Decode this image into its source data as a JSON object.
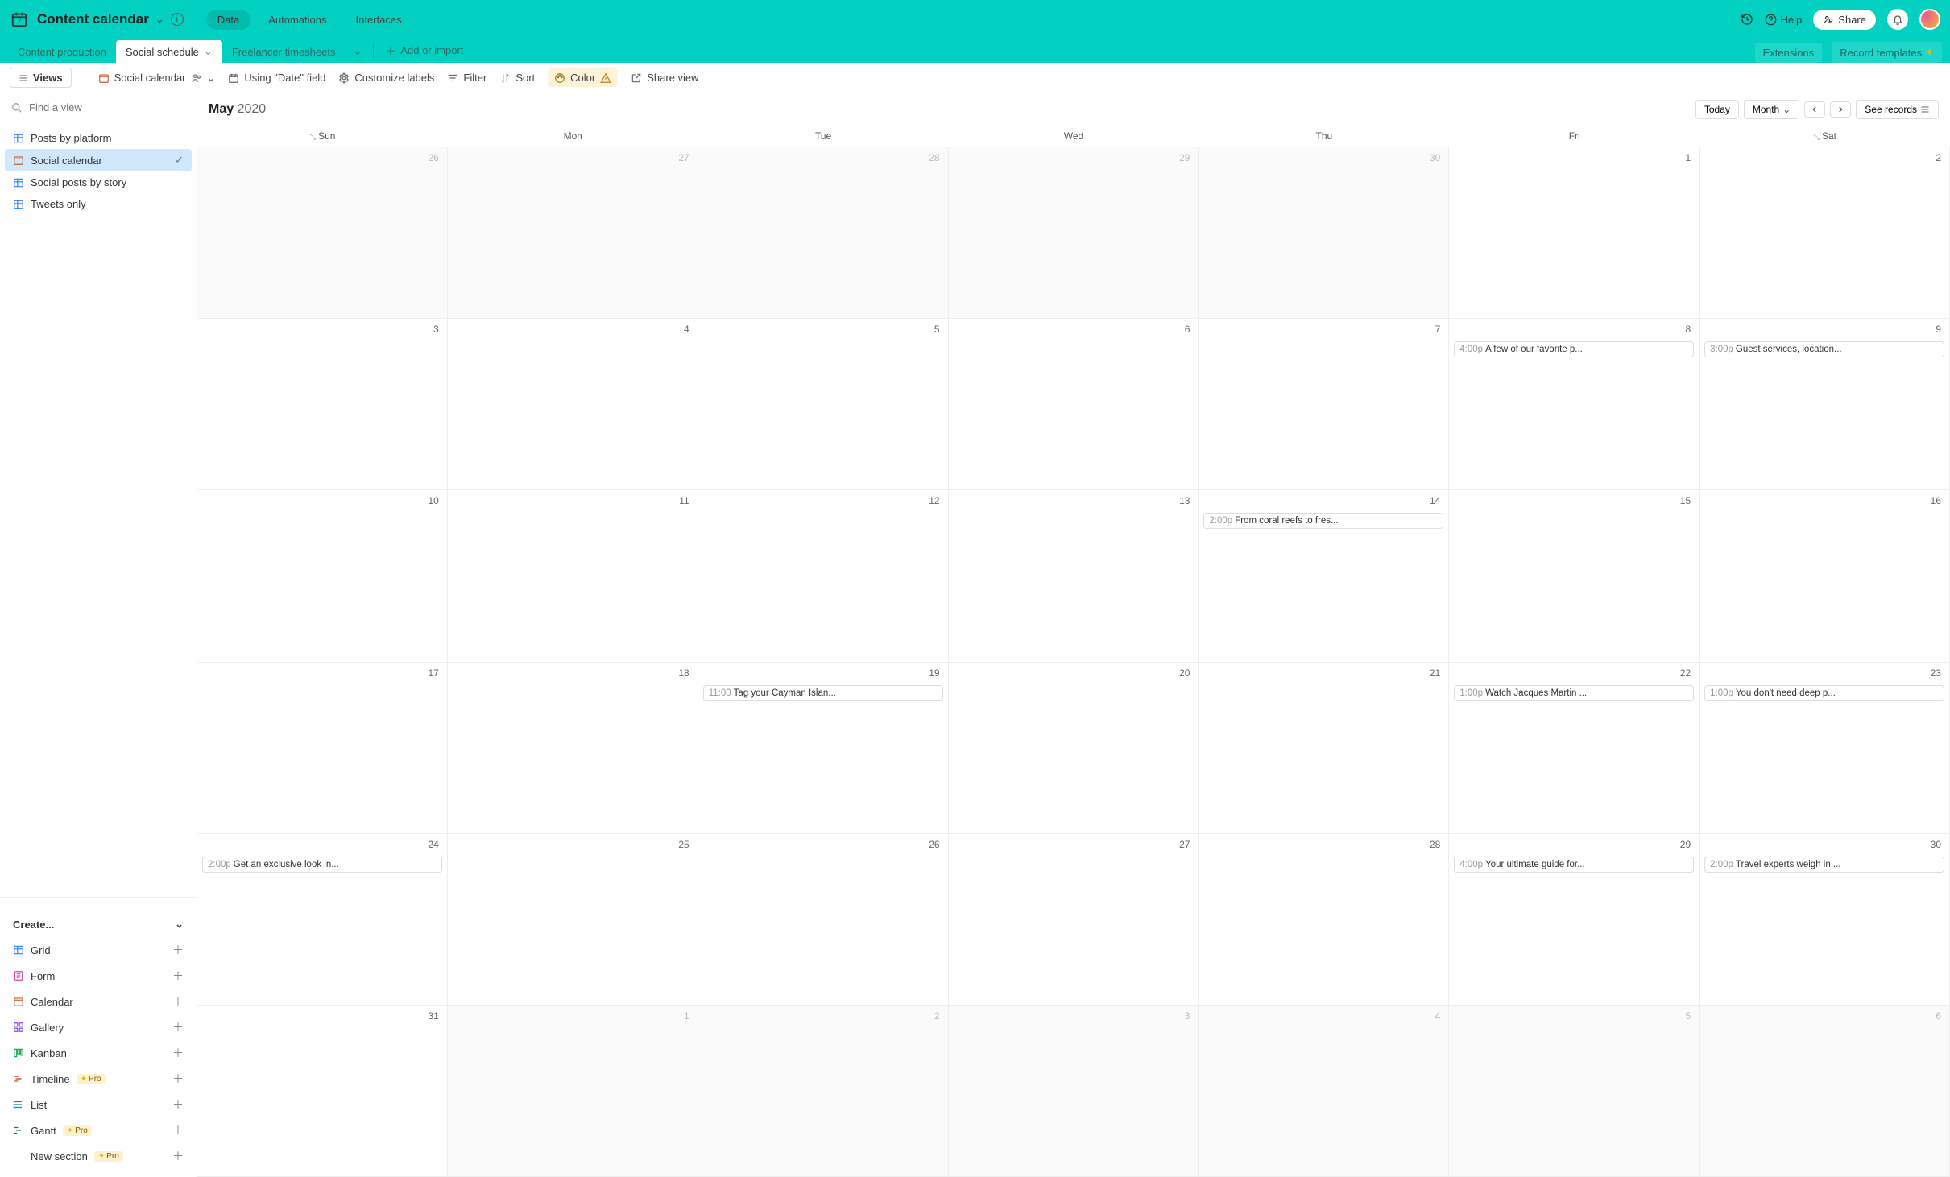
{
  "header": {
    "base_name": "Content calendar",
    "modes": {
      "data": "Data",
      "automations": "Automations",
      "interfaces": "Interfaces"
    },
    "help": "Help",
    "share": "Share"
  },
  "tables": {
    "tabs": [
      {
        "label": "Content production",
        "active": false
      },
      {
        "label": "Social schedule",
        "active": true
      },
      {
        "label": "Freelancer timesheets",
        "active": false
      }
    ],
    "add_or_import": "Add or import",
    "extensions": "Extensions",
    "record_templates": "Record templates"
  },
  "toolbar": {
    "views": "Views",
    "current_view": "Social calendar",
    "using_field": "Using \"Date\" field",
    "customize": "Customize labels",
    "filter": "Filter",
    "sort": "Sort",
    "color": "Color",
    "share_view": "Share view"
  },
  "sidebar": {
    "find_placeholder": "Find a view",
    "views": [
      {
        "label": "Posts by platform",
        "type": "grid",
        "active": false
      },
      {
        "label": "Social calendar",
        "type": "calendar",
        "active": true
      },
      {
        "label": "Social posts by story",
        "type": "grid",
        "active": false
      },
      {
        "label": "Tweets only",
        "type": "grid",
        "active": false
      }
    ],
    "create_label": "Create...",
    "create_items": [
      {
        "label": "Grid",
        "icon": "grid",
        "pro": false
      },
      {
        "label": "Form",
        "icon": "form",
        "pro": false
      },
      {
        "label": "Calendar",
        "icon": "calendar",
        "pro": false
      },
      {
        "label": "Gallery",
        "icon": "gallery",
        "pro": false
      },
      {
        "label": "Kanban",
        "icon": "kanban",
        "pro": false
      },
      {
        "label": "Timeline",
        "icon": "timeline",
        "pro": true
      },
      {
        "label": "List",
        "icon": "list",
        "pro": false
      },
      {
        "label": "Gantt",
        "icon": "gantt",
        "pro": true
      },
      {
        "label": "New section",
        "icon": "",
        "pro": true
      }
    ],
    "pro_label": "Pro"
  },
  "calendar": {
    "month": "May",
    "year": "2020",
    "today": "Today",
    "scope": "Month",
    "see_records": "See records",
    "day_headers": [
      "Sun",
      "Mon",
      "Tue",
      "Wed",
      "Thu",
      "Fri",
      "Sat"
    ],
    "weeks": [
      [
        {
          "n": 26,
          "of": true
        },
        {
          "n": 27,
          "of": true
        },
        {
          "n": 28,
          "of": true
        },
        {
          "n": 29,
          "of": true
        },
        {
          "n": 30,
          "of": true
        },
        {
          "n": 1
        },
        {
          "n": 2
        }
      ],
      [
        {
          "n": 3
        },
        {
          "n": 4
        },
        {
          "n": 5
        },
        {
          "n": 6
        },
        {
          "n": 7
        },
        {
          "n": 8,
          "events": [
            {
              "time": "4:00p",
              "title": "A few of our favorite p..."
            }
          ]
        },
        {
          "n": 9,
          "events": [
            {
              "time": "3:00p",
              "title": "Guest services, location..."
            }
          ]
        }
      ],
      [
        {
          "n": 10
        },
        {
          "n": 11
        },
        {
          "n": 12
        },
        {
          "n": 13
        },
        {
          "n": 14,
          "events": [
            {
              "time": "2:00p",
              "title": "From coral reefs to fres..."
            }
          ]
        },
        {
          "n": 15
        },
        {
          "n": 16
        }
      ],
      [
        {
          "n": 17
        },
        {
          "n": 18
        },
        {
          "n": 19,
          "events": [
            {
              "time": "11:00",
              "title": "Tag your Cayman Islan..."
            }
          ]
        },
        {
          "n": 20
        },
        {
          "n": 21
        },
        {
          "n": 22,
          "events": [
            {
              "time": "1:00p",
              "title": "Watch Jacques Martin ..."
            }
          ]
        },
        {
          "n": 23,
          "events": [
            {
              "time": "1:00p",
              "title": "You don't need deep p..."
            }
          ]
        }
      ],
      [
        {
          "n": 24,
          "events": [
            {
              "time": "2:00p",
              "title": "Get an exclusive look in..."
            }
          ]
        },
        {
          "n": 25
        },
        {
          "n": 26
        },
        {
          "n": 27
        },
        {
          "n": 28
        },
        {
          "n": 29,
          "events": [
            {
              "time": "4:00p",
              "title": "Your ultimate guide for..."
            }
          ]
        },
        {
          "n": 30,
          "events": [
            {
              "time": "2:00p",
              "title": "Travel experts weigh in ..."
            }
          ]
        }
      ],
      [
        {
          "n": 31
        },
        {
          "n": 1,
          "of": true
        },
        {
          "n": 2,
          "of": true
        },
        {
          "n": 3,
          "of": true
        },
        {
          "n": 4,
          "of": true
        },
        {
          "n": 5,
          "of": true
        },
        {
          "n": 6,
          "of": true
        }
      ]
    ]
  }
}
